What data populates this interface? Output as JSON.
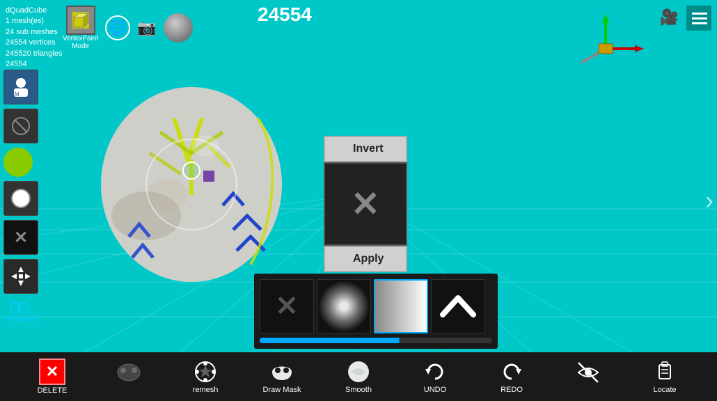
{
  "app": {
    "title": "dQuadCube",
    "mesh_count": "1 mesh(es)",
    "sub_meshes": "24 sub meshes",
    "vertices": "24554 vertices",
    "triangles": "245520 triangles",
    "vertex_count": "24554",
    "counter": "24554"
  },
  "top_icons": {
    "vertex_paint_label": "VertexPaint",
    "mode_label": "Mode"
  },
  "invert_panel": {
    "invert_label": "Invert",
    "apply_label": "Apply",
    "x_symbol": "✕"
  },
  "brush_panel": {
    "x_symbol": "✕",
    "chevron_symbol": "^"
  },
  "bottom_toolbar": {
    "delete_label": "DELETE",
    "delete_icon": "✕",
    "remesh_label": "remesh",
    "draw_mask_label": "Draw Mask",
    "smooth_label": "Smooth",
    "undo_label": "UNDO",
    "redo_label": "REDO",
    "locate_label": "Locate",
    "objects_label": "+Objects"
  },
  "colors": {
    "background": "#00c8c8",
    "toolbar_bg": "#1a1a1a",
    "panel_bg": "#d0d0d0",
    "accent_blue": "#00aaff"
  }
}
